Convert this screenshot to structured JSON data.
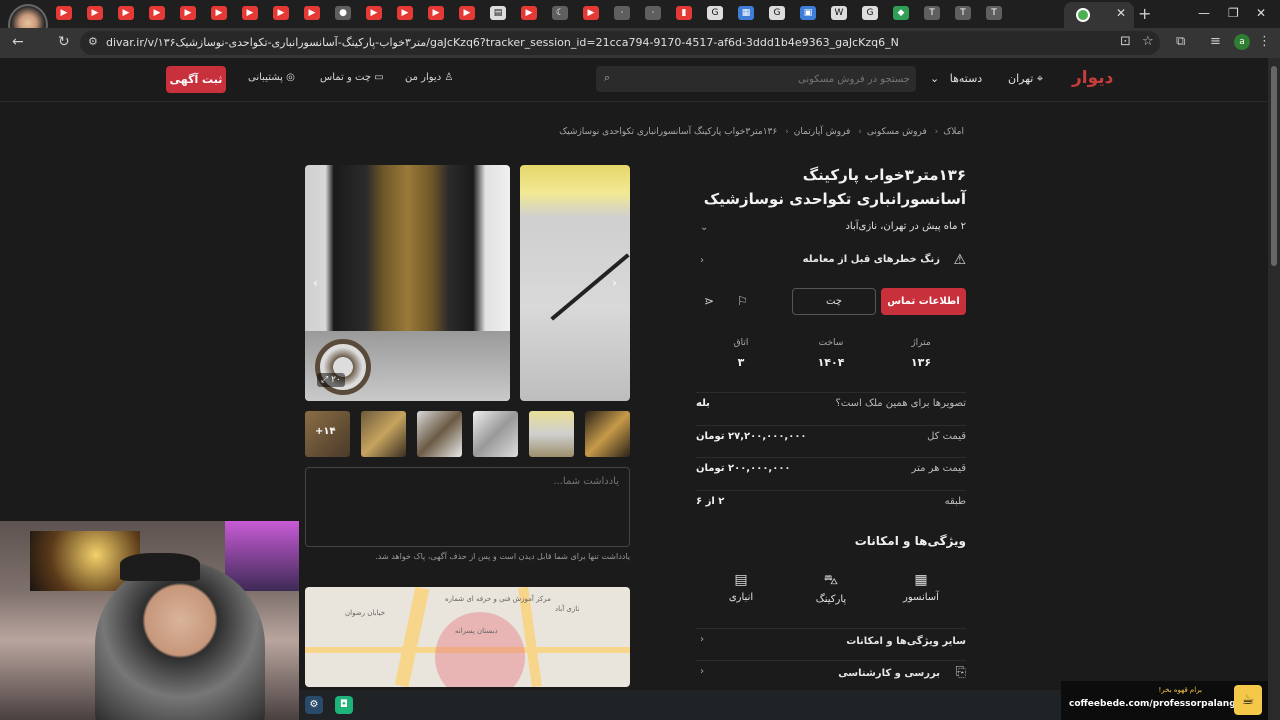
{
  "browser": {
    "url": "divar.ir/v/۱۳۶متر۳خواب-پارکینگ-آسانسورانباری-تکواحدی-نوسازشیک/gaJcKzq6?tracker_session_id=21cca794-9170-4517-af6d-3ddd1b4e9363_gaJcKzq6_N",
    "profile_initial": "a",
    "new_tab": "+",
    "close": "✕"
  },
  "header": {
    "logo": "دیوار",
    "city": "تهران",
    "categories": "دسته‌ها",
    "search_placeholder": "جستجو در فروش مسکونی",
    "my_divar": "دیوار من",
    "chat": "چت و تماس",
    "support": "پشتیبانی",
    "post_ad": "ثبت آگهی"
  },
  "breadcrumb": [
    "املاک",
    "فروش مسکونی",
    "فروش آپارتمان",
    "۱۳۶متر۳خواب پارکینگ آسانسورانباری تکواحدی نوسازشیک"
  ],
  "gallery": {
    "image_count": "۲۰",
    "more_count": "+۱۴"
  },
  "note": {
    "placeholder": "یادداشت شما...",
    "hint": "یادداشت تنها برای شما قابل دیدن است و پس از حذف آگهی، پاک خواهد شد."
  },
  "ad": {
    "title": "۱۳۶متر۳خواب پارکینگ آسانسورانباری تکواحدی نوسازشیک",
    "subtitle": "۲ ماه پیش در تهران، نازی‌آباد",
    "warning": "زنگ خطرهای قبل از معامله",
    "contact_button": "اطلاعات تماس",
    "chat_button": "چت",
    "stats": [
      {
        "label": "متراژ",
        "value": "۱۳۶"
      },
      {
        "label": "ساخت",
        "value": "۱۴۰۴"
      },
      {
        "label": "اتاق",
        "value": "۳"
      }
    ],
    "details": [
      {
        "label": "تصویرها برای همین ملک است؟",
        "value": "بله"
      },
      {
        "label": "قیمت کل",
        "value": "۲۷,۲۰۰,۰۰۰,۰۰۰ تومان"
      },
      {
        "label": "قیمت هر متر",
        "value": "۲۰۰,۰۰۰,۰۰۰ تومان"
      },
      {
        "label": "طبقه",
        "value": "۲ از ۶"
      }
    ],
    "features_title": "ویژگی‌ها و امکانات",
    "features": [
      "آسانسور",
      "پارکینگ",
      "انباری"
    ],
    "more_features": "سایر ویژگی‌ها و امکانات",
    "review": "بررسی و کارشناسی"
  },
  "map": {
    "labels": [
      "مرکز آموزش فنی و حرفه ای شماره",
      "دبستان پسرانه",
      "خیابان رضوان",
      "نازی آباد"
    ]
  },
  "overlay": {
    "coffee_title": "برام قهوه بخر!",
    "coffee_url": "coffeebede.com/professorpalang"
  }
}
